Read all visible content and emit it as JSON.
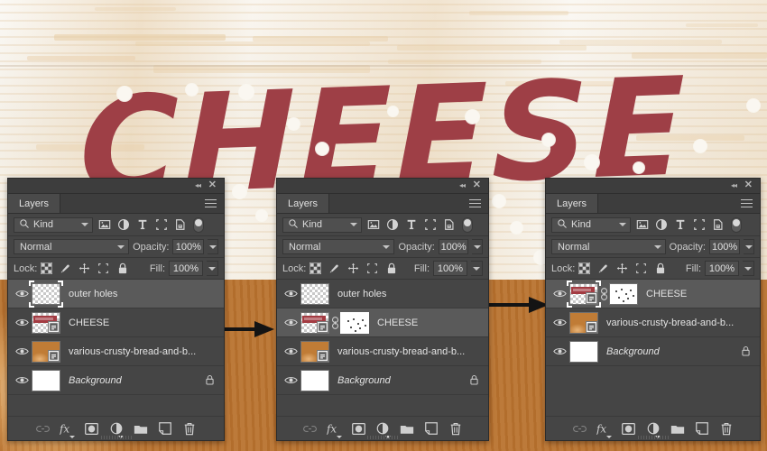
{
  "artboard": {
    "headline": "CHEESE",
    "headline_color": "#9e3f46",
    "background_desc": "white-washed wood board with crusty bread loaves"
  },
  "arrows": [
    {
      "name": "arrow-panel1-to-panel2"
    },
    {
      "name": "arrow-panel2-to-panel3"
    }
  ],
  "panel_common": {
    "tab_label": "Layers",
    "collapse_icon": "◂◂",
    "close_icon": "✕",
    "menu_icon": "hamburger-menu-icon",
    "filter": {
      "search_icon": "search-icon",
      "kind_label": "Kind",
      "icons": [
        "pixel-layer-filter-icon",
        "adjustment-layer-filter-icon",
        "type-layer-filter-icon",
        "shape-layer-filter-icon",
        "smart-object-filter-icon"
      ],
      "toggle": "filter-enable-toggle"
    },
    "blend": {
      "mode": "Normal",
      "opacity_label": "Opacity:",
      "opacity_value": "100%"
    },
    "lock": {
      "label": "Lock:",
      "icons": [
        "lock-transparent-pixels-icon",
        "lock-image-pixels-icon",
        "lock-position-icon",
        "lock-artboard-nesting-icon",
        "lock-all-icon"
      ],
      "fill_label": "Fill:",
      "fill_value": "100%"
    },
    "footer_buttons": [
      {
        "name": "link-layers-button",
        "icon": "link-icon"
      },
      {
        "name": "add-layer-style-button",
        "icon": "fx-icon"
      },
      {
        "name": "add-layer-mask-button",
        "icon": "mask-icon"
      },
      {
        "name": "new-fill-adjustment-layer-button",
        "icon": "half-circle-icon"
      },
      {
        "name": "new-group-button",
        "icon": "folder-icon"
      },
      {
        "name": "new-layer-button",
        "icon": "new-layer-icon"
      },
      {
        "name": "delete-layer-button",
        "icon": "trash-icon"
      }
    ]
  },
  "panels": [
    {
      "id": "panel-1",
      "layers": [
        {
          "name": "outer holes",
          "selected": true,
          "thumb": "transparent",
          "has_smart_object_badge": false,
          "has_mask": false,
          "locked": false,
          "italic": false
        },
        {
          "name": "CHEESE",
          "selected": false,
          "thumb": "cheese",
          "has_smart_object_badge": true,
          "has_mask": false,
          "locked": false,
          "italic": false
        },
        {
          "name": "various-crusty-bread-and-b...",
          "selected": false,
          "thumb": "bread",
          "has_smart_object_badge": true,
          "has_mask": false,
          "locked": false,
          "italic": false
        },
        {
          "name": "Background",
          "selected": false,
          "thumb": "white",
          "has_smart_object_badge": false,
          "has_mask": false,
          "locked": true,
          "italic": true
        }
      ]
    },
    {
      "id": "panel-2",
      "layers": [
        {
          "name": "outer holes",
          "selected": false,
          "thumb": "transparent",
          "has_smart_object_badge": false,
          "has_mask": false,
          "locked": false,
          "italic": false
        },
        {
          "name": "CHEESE",
          "selected": true,
          "thumb": "cheese",
          "has_smart_object_badge": true,
          "has_mask": true,
          "mask_selected": true,
          "locked": false,
          "italic": false
        },
        {
          "name": "various-crusty-bread-and-b...",
          "selected": false,
          "thumb": "bread",
          "has_smart_object_badge": true,
          "has_mask": false,
          "locked": false,
          "italic": false
        },
        {
          "name": "Background",
          "selected": false,
          "thumb": "white",
          "has_smart_object_badge": false,
          "has_mask": false,
          "locked": true,
          "italic": true
        }
      ]
    },
    {
      "id": "panel-3",
      "layers": [
        {
          "name": "CHEESE",
          "selected": true,
          "thumb": "cheese",
          "has_smart_object_badge": true,
          "has_mask": true,
          "mask_selected": false,
          "locked": false,
          "italic": false
        },
        {
          "name": "various-crusty-bread-and-b...",
          "selected": false,
          "thumb": "bread",
          "has_smart_object_badge": true,
          "has_mask": false,
          "locked": false,
          "italic": false
        },
        {
          "name": "Background",
          "selected": false,
          "thumb": "white",
          "has_smart_object_badge": false,
          "has_mask": false,
          "locked": true,
          "italic": true
        }
      ]
    }
  ]
}
